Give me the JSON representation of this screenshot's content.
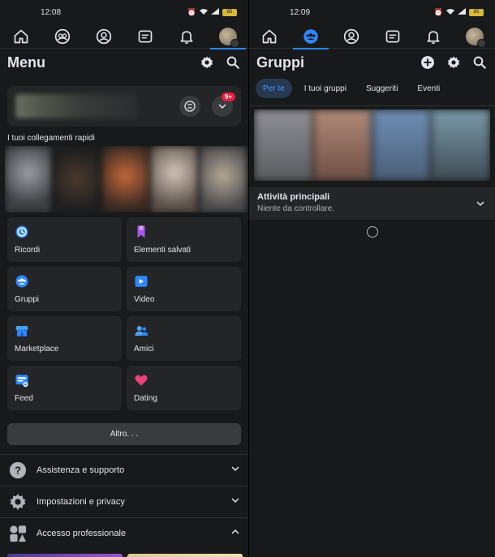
{
  "left": {
    "status": {
      "time": "12:08",
      "battery": "85"
    },
    "title": "Menu",
    "notification_count": "9+",
    "shortcuts_label": "I tuoi collegamenti rapidi",
    "tiles": [
      {
        "label": "Ricordi",
        "icon": "clock-memories-icon"
      },
      {
        "label": "Elementi salvati",
        "icon": "bookmark-icon"
      },
      {
        "label": "Gruppi",
        "icon": "groups-icon"
      },
      {
        "label": "Video",
        "icon": "video-play-icon"
      },
      {
        "label": "Marketplace",
        "icon": "marketplace-shop-icon"
      },
      {
        "label": "Amici",
        "icon": "friends-icon"
      },
      {
        "label": "Feed",
        "icon": "feed-icon"
      },
      {
        "label": "Dating",
        "icon": "heart-icon"
      }
    ],
    "more_label": "Altro. . .",
    "list": [
      {
        "label": "Assistenza e supporto",
        "icon": "help-icon"
      },
      {
        "label": "Impostazioni e privacy",
        "icon": "gear-icon"
      },
      {
        "label": "Accesso professionale",
        "icon": "professional-icon"
      }
    ]
  },
  "right": {
    "status": {
      "time": "12:09",
      "battery": "85"
    },
    "title": "Gruppi",
    "pills": [
      "Per te",
      "I tuoi gruppi",
      "Suggeriti",
      "Eventi"
    ],
    "activity": {
      "title": "Attività principali",
      "subtitle": "Niente da controllare."
    }
  },
  "colors": {
    "background": "#18191a",
    "card": "#242526",
    "accent": "#2d88ff",
    "badge": "#e41e3f"
  }
}
